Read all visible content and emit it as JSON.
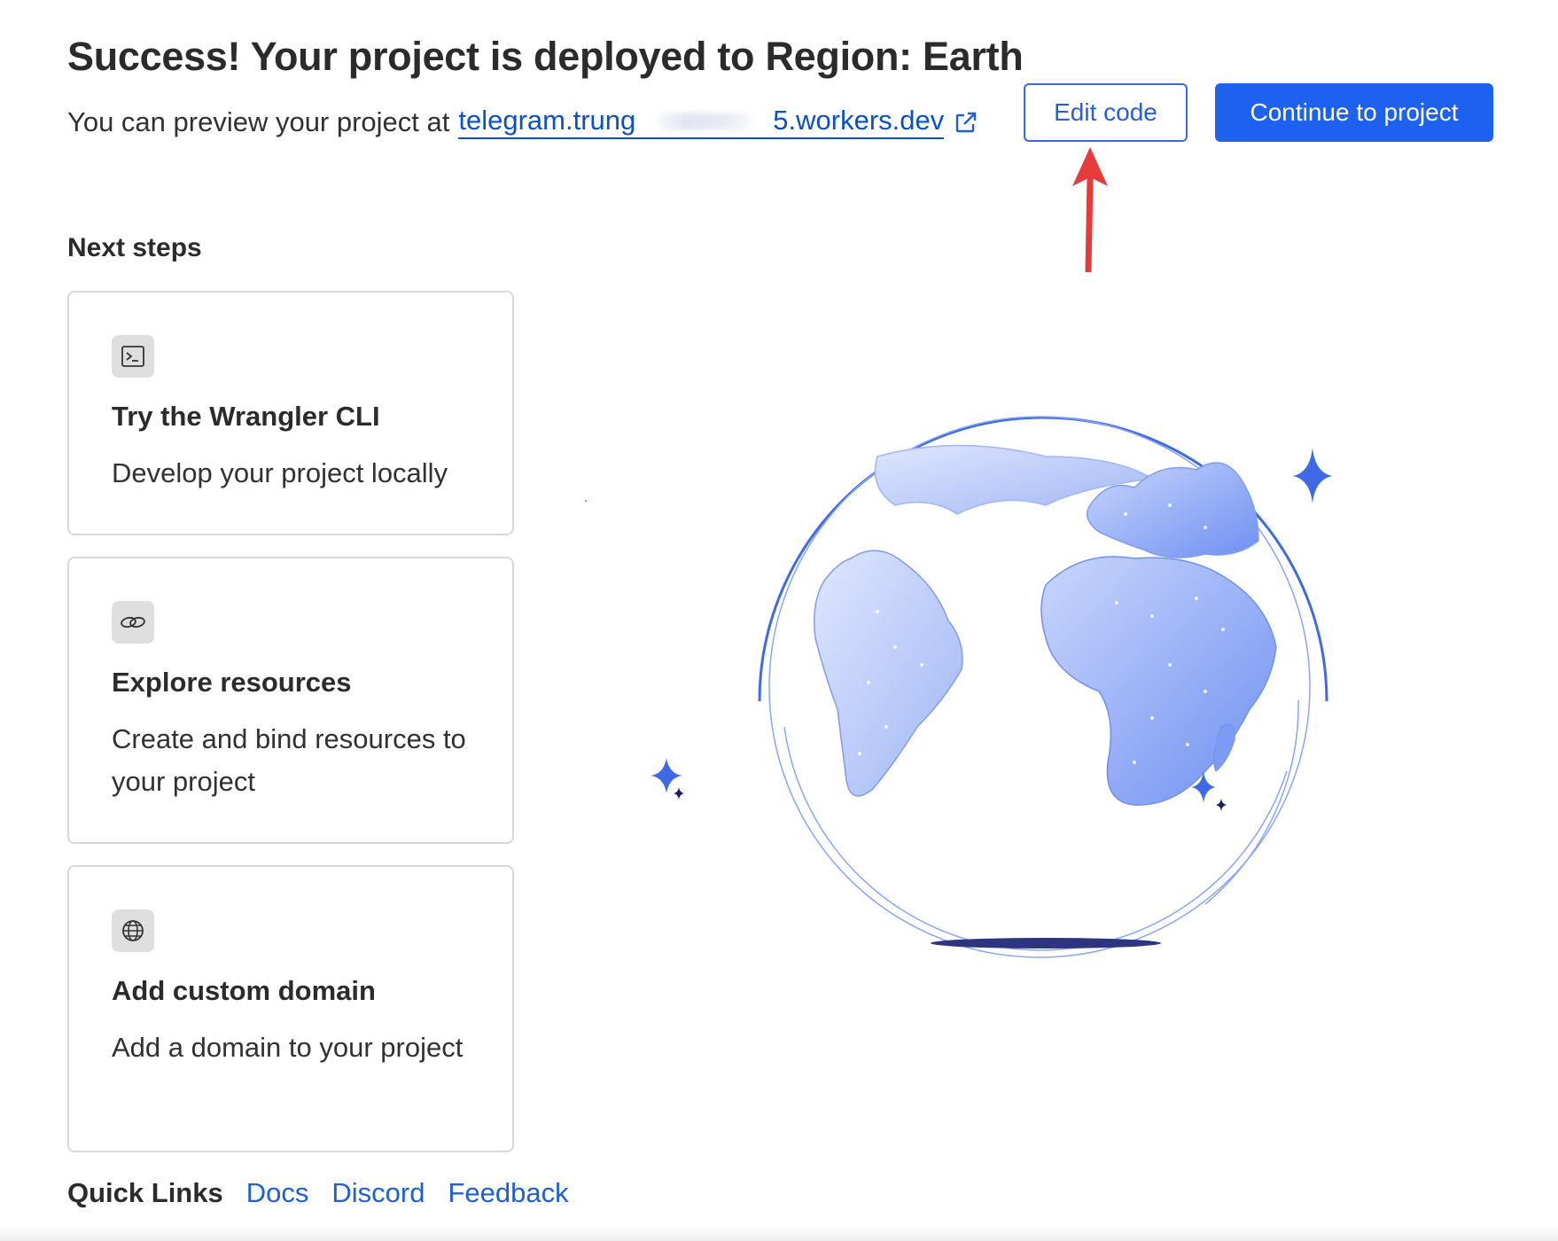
{
  "header": {
    "title": "Success! Your project is deployed to Region: Earth",
    "preview_text": "You can preview your project at",
    "preview_url_start": "telegram.trung",
    "preview_url_end": "5.workers.dev",
    "icons": {
      "external": "external-link-icon"
    }
  },
  "actions": {
    "edit_label": "Edit code",
    "continue_label": "Continue to project",
    "colors": {
      "primary": "#1f61ef",
      "outline": "#3569e8",
      "annotation_arrow": "#e53b3b"
    }
  },
  "next_steps": {
    "heading": "Next steps",
    "cards": [
      {
        "icon": "terminal-icon",
        "title": "Try the Wrangler CLI",
        "description": "Develop your project locally"
      },
      {
        "icon": "link-icon",
        "title": "Explore resources",
        "description": "Create and bind resources to your project"
      },
      {
        "icon": "globe-icon",
        "title": "Add custom domain",
        "description": "Add a domain to your project"
      }
    ]
  },
  "quick_links": {
    "label": "Quick Links",
    "links": [
      "Docs",
      "Discord",
      "Feedback"
    ]
  },
  "illustration": {
    "icon": "earth-globe-illustration",
    "colors": {
      "globe": "#7c9cf4",
      "ring": "#3e6ae6",
      "shadow": "#2e3580",
      "sparkle": "#3e6ae6",
      "sparkle_dark": "#1b1f5e"
    }
  }
}
